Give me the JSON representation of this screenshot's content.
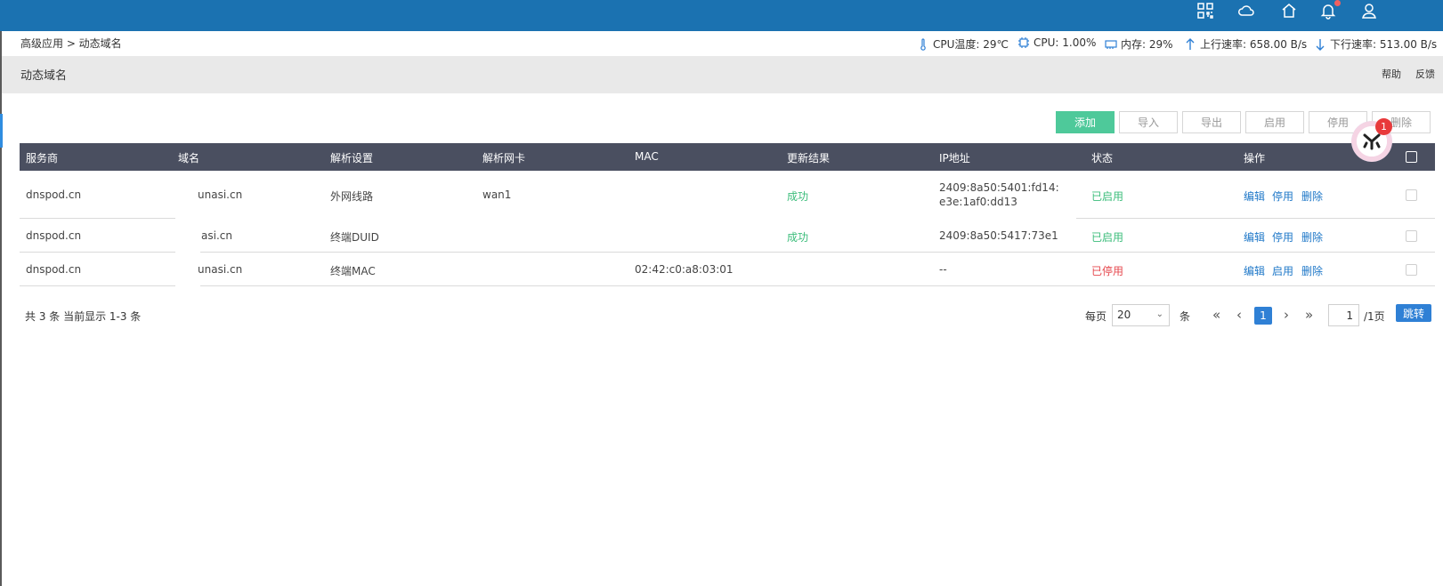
{
  "breadcrumb": "高级应用 > 动态域名",
  "stats": {
    "cpu_temp": "CPU温度: 29℃",
    "cpu": "CPU: 1.00%",
    "memory": "内存: 29%",
    "upload": "上行速率: 658.00 B/s",
    "download": "下行速率: 513.00 B/s"
  },
  "page": {
    "title": "动态域名",
    "help": "帮助",
    "feedback": "反馈"
  },
  "toolbar": {
    "add": "添加",
    "import": "导入",
    "export": "导出",
    "enable": "启用",
    "disable": "停用",
    "delete": "删除"
  },
  "table": {
    "headers": [
      "服务商",
      "域名",
      "解析设置",
      "解析网卡",
      "MAC",
      "更新结果",
      "IP地址",
      "状态",
      "操作"
    ],
    "rows": [
      {
        "provider": "dnspod.cn",
        "domain": "unasi.cn",
        "setting": "外网线路",
        "nic": "wan1",
        "mac": "",
        "result": "成功",
        "ip": "2409:8a50:5401:fd14:",
        "ip2": "e3e:1af0:dd13",
        "status": "已启用",
        "op1": "编辑",
        "op2": "停用",
        "op3": "删除"
      },
      {
        "provider": "dnspod.cn",
        "domain": "asi.cn",
        "setting": "终端DUID",
        "nic": "",
        "mac": "",
        "result": "成功",
        "ip": "2409:8a50:5417:73e1",
        "status": "已启用",
        "op1": "编辑",
        "op2": "停用",
        "op3": "删除"
      },
      {
        "provider": "dnspod.cn",
        "domain": "unasi.cn",
        "setting": "终端MAC",
        "nic": "",
        "mac": "02:42:c0:a8:03:01",
        "result": "",
        "ip": "--",
        "status": "已停用",
        "op1": "编辑",
        "op2": "启用",
        "op3": "删除"
      }
    ]
  },
  "pagination": {
    "summary": "共 3 条 当前显示 1-3 条",
    "per_page_label": "每页",
    "per_page_value": "20",
    "unit": "条",
    "current_page": "1",
    "page_input": "1",
    "total_pages": "/1页",
    "go": "跳转"
  },
  "floating": {
    "badge": "1"
  },
  "colors": {
    "topbar": "#1b72b1",
    "table_header": "#4a4f60",
    "primary": "#4ec99a",
    "link": "#1f78c8",
    "success": "#3cbd7b",
    "danger": "#e6484e"
  },
  "icons": [
    "apps-icon",
    "cloud-icon",
    "home-icon",
    "bell-icon",
    "user-icon",
    "thermometer-icon",
    "chip-icon",
    "memory-icon",
    "arrow-up-icon",
    "arrow-down-icon"
  ]
}
